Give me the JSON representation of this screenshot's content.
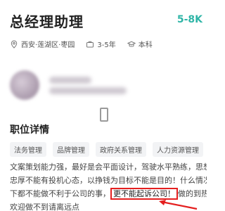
{
  "job": {
    "title": "总经理助理",
    "salary": "5-8K"
  },
  "meta": {
    "location": "西安·莲湖区·枣园",
    "experience": "3-5年",
    "education": "本科"
  },
  "section": {
    "title": "职位详情"
  },
  "tags": [
    "法务管理",
    "品牌管理",
    "政府关系管理",
    "人力资源管理"
  ],
  "description": {
    "line1": "文案策划能力强，最好是会平面设计，驾驶水平熟练，思想",
    "line2": "忠厚不能有投机心态，以挣钱为目标不能是目的！什么情况",
    "line3_pre": "下都不能做不利于公司的事，",
    "line3_highlight": "更不能起诉公司！",
    "line3_post": "做的到热烈",
    "line4": "欢迎做不到请离远点"
  },
  "colors": {
    "accent": "#2fb5a7",
    "highlight": "#e41f1f"
  }
}
